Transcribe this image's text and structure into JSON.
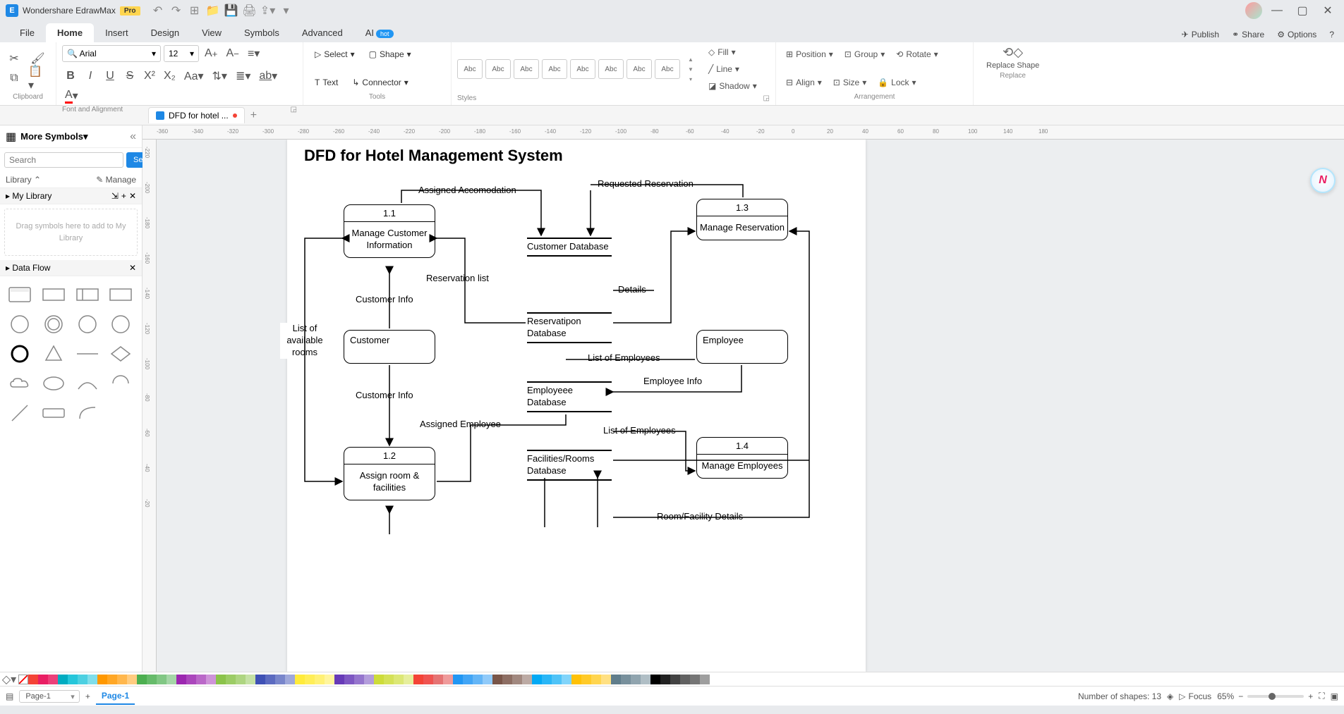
{
  "app": {
    "title": "Wondershare EdrawMax",
    "pro": "Pro"
  },
  "menubar": {
    "tabs": [
      "File",
      "Home",
      "Insert",
      "Design",
      "View",
      "Symbols",
      "Advanced",
      "AI"
    ],
    "active": "Home",
    "ai_badge": "hot",
    "right": {
      "publish": "Publish",
      "share": "Share",
      "options": "Options"
    }
  },
  "ribbon": {
    "clipboard": {
      "label": "Clipboard"
    },
    "font": {
      "label": "Font and Alignment",
      "font_name": "Arial",
      "font_size": "12"
    },
    "tools": {
      "label": "Tools",
      "select": "Select",
      "shape": "Shape",
      "text": "Text",
      "connector": "Connector"
    },
    "styles": {
      "label": "Styles",
      "swatch": "Abc"
    },
    "format": {
      "fill": "Fill",
      "line": "Line",
      "shadow": "Shadow",
      "position": "Position",
      "align": "Align",
      "group": "Group",
      "size": "Size",
      "rotate": "Rotate",
      "lock": "Lock"
    },
    "arrangement": {
      "label": "Arrangement"
    },
    "replace": {
      "label": "Replace",
      "btn": "Replace Shape"
    }
  },
  "doc_tab": {
    "name": "DFD for hotel ..."
  },
  "sidebar": {
    "more_symbols": "More Symbols",
    "search_placeholder": "Search",
    "search_btn": "Search",
    "library": "Library",
    "manage": "Manage",
    "my_library": "My Library",
    "dropzone": "Drag symbols here to add to My Library",
    "data_flow": "Data Flow"
  },
  "diagram": {
    "title": "DFD for Hotel Management System",
    "p1_num": "1.1",
    "p1_name": "Manage Customer Information",
    "p2_num": "1.2",
    "p2_name": "Assign room & facilities",
    "p3_num": "1.3",
    "p3_name": "Manage Reservation",
    "p4_num": "1.4",
    "p4_name": "Manage Employees",
    "e_customer": "Customer",
    "e_employee": "Employee",
    "ds_customer": "Customer Database",
    "ds_reservation": "Reservatipon Database",
    "ds_employee": "Employeee Database",
    "ds_facilities": "Facilities/Rooms Database",
    "lbl_assigned_acc": "Assigned Accomodation",
    "lbl_req_res": "Requested Reservation",
    "lbl_res_list": "Reservation list",
    "lbl_details": "Details",
    "lbl_cust_info1": "Customer Info",
    "lbl_cust_info2": "Customer Info",
    "lbl_list_rooms": "List of available rooms",
    "lbl_assigned_emp": "Assigned Employee",
    "lbl_list_emp1": "List of Employees",
    "lbl_list_emp2": "List of Employees",
    "lbl_emp_info": "Employee Info",
    "lbl_room_details": "Room/Facility Details"
  },
  "ruler_h": [
    "-360",
    "-340",
    "-320",
    "-300",
    "-280",
    "-260",
    "-240",
    "-220",
    "-200",
    "-180",
    "-160",
    "-140",
    "-120",
    "-100",
    "-80",
    "-60",
    "-40",
    "-20",
    "0",
    "20",
    "40",
    "60",
    "80",
    "100",
    "140",
    "180"
  ],
  "ruler_v": [
    "-220",
    "-200",
    "-180",
    "-160",
    "-140",
    "-120",
    "-100",
    "-80",
    "-60",
    "-40",
    "-20"
  ],
  "colors": [
    "#f44336",
    "#e91e63",
    "#ec407a",
    "#00acc1",
    "#26c6da",
    "#4dd0e1",
    "#80deea",
    "#ff9800",
    "#ffa726",
    "#ffb74d",
    "#ffcc80",
    "#4caf50",
    "#66bb6a",
    "#81c784",
    "#a5d6a7",
    "#9c27b0",
    "#ab47bc",
    "#ba68c8",
    "#ce93d8",
    "#8bc34a",
    "#9ccc65",
    "#aed581",
    "#c5e1a5",
    "#3f51b5",
    "#5c6bc0",
    "#7986cb",
    "#9fa8da",
    "#ffeb3b",
    "#ffee58",
    "#fff176",
    "#fff59d",
    "#673ab7",
    "#7e57c2",
    "#9575cd",
    "#b39ddb",
    "#cddc39",
    "#d4e157",
    "#dce775",
    "#e6ee9c",
    "#f44336",
    "#ef5350",
    "#e57373",
    "#ef9a9a",
    "#2196f3",
    "#42a5f5",
    "#64b5f6",
    "#90caf9",
    "#795548",
    "#8d6e63",
    "#a1887f",
    "#bcaaa4",
    "#03a9f4",
    "#29b6f6",
    "#4fc3f7",
    "#81d4fa",
    "#ffc107",
    "#ffca28",
    "#ffd54f",
    "#ffe082",
    "#607d8b",
    "#78909c",
    "#90a4ae",
    "#b0bec5",
    "#000000",
    "#212121",
    "#424242",
    "#616161",
    "#757575",
    "#9e9e9e"
  ],
  "status": {
    "page_selector": "Page-1",
    "active_page": "Page-1",
    "shapes": "Number of shapes: 13",
    "focus": "Focus",
    "zoom": "65%"
  }
}
